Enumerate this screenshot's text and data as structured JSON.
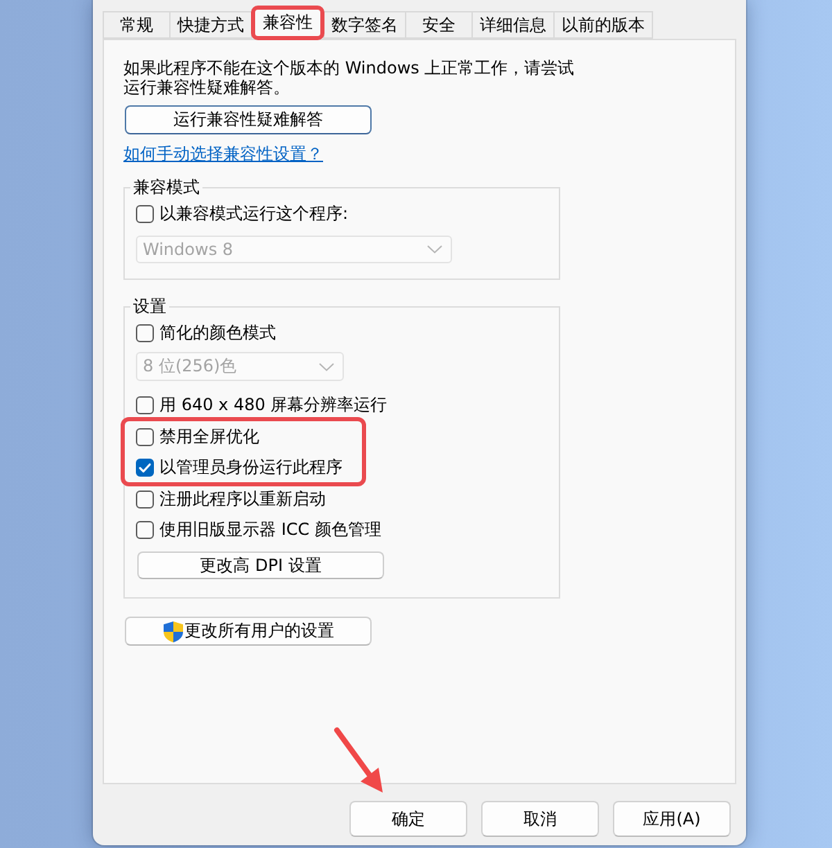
{
  "tabs": [
    {
      "label": "常规",
      "selected": false,
      "highlighted": false
    },
    {
      "label": "快捷方式",
      "selected": false,
      "highlighted": false
    },
    {
      "label": "兼容性",
      "selected": true,
      "highlighted": true
    },
    {
      "label": "数字签名",
      "selected": false,
      "highlighted": false
    },
    {
      "label": "安全",
      "selected": false,
      "highlighted": false
    },
    {
      "label": "详细信息",
      "selected": false,
      "highlighted": false
    },
    {
      "label": "以前的版本",
      "selected": false,
      "highlighted": false
    }
  ],
  "intro": "如果此程序不能在这个版本的 Windows 上正常工作，请尝试运行兼容性疑难解答。",
  "troubleshoot_button": {
    "label": "运行兼容性疑难解答",
    "default": true
  },
  "help_link": "如何手动选择兼容性设置？",
  "compat_mode": {
    "title": "兼容模式",
    "checkbox": {
      "label": "以兼容模式运行这个程序:",
      "checked": false
    },
    "dropdown": {
      "value": "Windows 8",
      "disabled": true
    }
  },
  "settings": {
    "title": "设置",
    "items": [
      {
        "kind": "checkbox",
        "label": "简化的颜色模式",
        "checked": false,
        "highlighted": false
      },
      {
        "kind": "dropdown",
        "value": "8 位(256)色",
        "disabled": true
      },
      {
        "kind": "checkbox",
        "label": "用 640 x 480 屏幕分辨率运行",
        "checked": false,
        "highlighted": false
      },
      {
        "kind": "checkbox",
        "label": "禁用全屏优化",
        "checked": false,
        "highlighted": true
      },
      {
        "kind": "checkbox",
        "label": "以管理员身份运行此程序",
        "checked": true,
        "highlighted": true
      },
      {
        "kind": "checkbox",
        "label": "注册此程序以重新启动",
        "checked": false,
        "highlighted": false
      },
      {
        "kind": "checkbox",
        "label": "使用旧版显示器 ICC 颜色管理",
        "checked": false,
        "highlighted": false
      },
      {
        "kind": "button",
        "label": "更改高 DPI 设置"
      }
    ]
  },
  "all_users_button": {
    "label": "更改所有用户的设置"
  },
  "buttons": [
    {
      "label": "确定",
      "highlighted": true
    },
    {
      "label": "取消",
      "highlighted": false
    },
    {
      "label": "应用(A)",
      "highlighted": false
    }
  ]
}
